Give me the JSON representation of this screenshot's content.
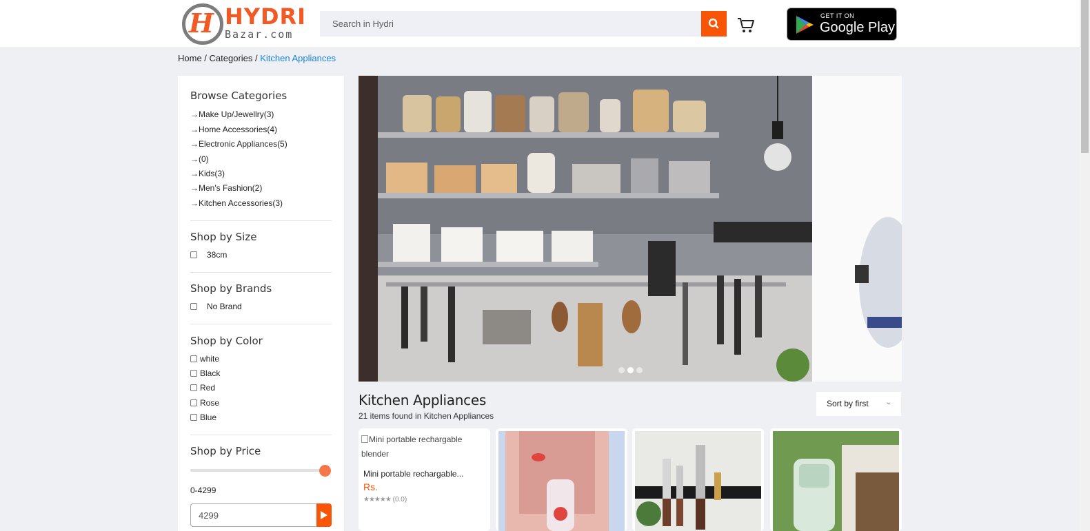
{
  "header": {
    "logo_text_main": "HYDRI",
    "logo_text_sub": "Bazar.com",
    "logo_letter": "H",
    "search_placeholder": "Search in Hydri",
    "gplay_small": "GET IT ON",
    "gplay_big": "Google Play"
  },
  "breadcrumb": {
    "home": "Home",
    "sep1": " / ",
    "categories": "Categories",
    "sep2": " / ",
    "current": "Kitchen Appliances"
  },
  "sidebar": {
    "browse_title": "Browse Categories",
    "categories": [
      {
        "label": "Make Up/Jewellry(3)"
      },
      {
        "label": "Home Accessories(4)"
      },
      {
        "label": "Electronic Appliances(5)"
      },
      {
        "label": "(0)"
      },
      {
        "label": "Kids(3)"
      },
      {
        "label": "Men's Fashion(2)"
      },
      {
        "label": "Kitchen Accessories(3)"
      }
    ],
    "size_title": "Shop by Size",
    "sizes": [
      {
        "label": "38cm",
        "checked": false
      }
    ],
    "brands_title": "Shop by Brands",
    "brands": [
      {
        "label": "No Brand",
        "checked": false
      }
    ],
    "color_title": "Shop by Color",
    "colors": [
      {
        "label": "white",
        "checked": false
      },
      {
        "label": "Black",
        "checked": false
      },
      {
        "label": "Red",
        "checked": false
      },
      {
        "label": "Rose",
        "checked": false
      },
      {
        "label": "Blue",
        "checked": false
      }
    ],
    "price_title": "Shop by Price",
    "price_range_text": "0-4299",
    "price_slider_fraction": 1.0,
    "price_input_value": "4299"
  },
  "banner": {
    "slides": 3,
    "active_slide": 1
  },
  "listing": {
    "title": "Kitchen Appliances",
    "count_text": "21 items found in Kitchen Appliances",
    "sort_label": "Sort by first",
    "products": [
      {
        "image_alt": "Mini portable rechargable blender",
        "name": "Mini portable rechargable...",
        "price": "Rs.",
        "rating_text": "(0.0)",
        "image_loaded": false
      },
      {
        "image_kind": "blender-juice",
        "image_loaded": true
      },
      {
        "image_kind": "knife-magnet-rack",
        "image_loaded": true
      },
      {
        "image_kind": "portable-blender-bottle",
        "image_loaded": true
      }
    ]
  },
  "colors": {
    "accent": "#f85606",
    "link": "#1a82e2",
    "page_bg": "#eef0f4"
  }
}
